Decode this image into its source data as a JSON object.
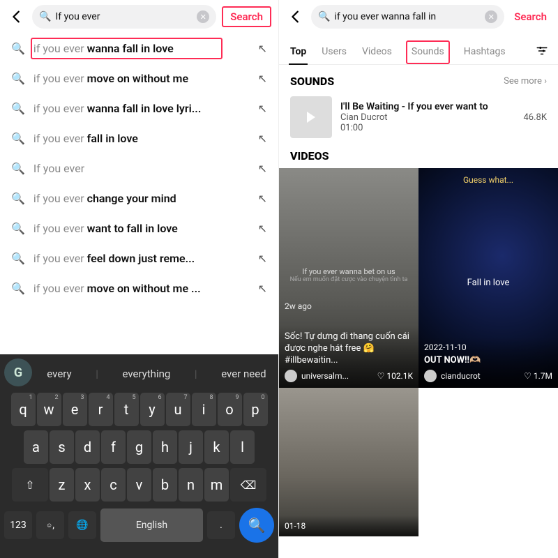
{
  "left": {
    "search_value": "If you ever",
    "search_button": "Search",
    "suggestions": [
      {
        "light": "if you ever ",
        "bold": "wanna fall in love"
      },
      {
        "light": "if you ever ",
        "bold": "move on without me"
      },
      {
        "light": "if you ever ",
        "bold": "wanna fall in love lyri..."
      },
      {
        "light": "if you ever ",
        "bold": "fall in love"
      },
      {
        "light": "If you ever",
        "bold": ""
      },
      {
        "light": "if you ever ",
        "bold": "change your mind"
      },
      {
        "light": "if you ever ",
        "bold": "want to fall in love"
      },
      {
        "light": "if you ever ",
        "bold": "feel down just reme..."
      },
      {
        "light": "if you ever ",
        "bold": "move on without me ..."
      }
    ],
    "keyboard": {
      "predictions": [
        "every",
        "everything",
        "ever need"
      ],
      "row1_sups": [
        "1",
        "2",
        "3",
        "4",
        "5",
        "6",
        "7",
        "8",
        "9",
        "0"
      ],
      "row1": [
        "q",
        "w",
        "e",
        "r",
        "t",
        "y",
        "u",
        "i",
        "o",
        "p"
      ],
      "row2": [
        "a",
        "s",
        "d",
        "f",
        "g",
        "h",
        "j",
        "k",
        "l"
      ],
      "row3": [
        "z",
        "x",
        "c",
        "v",
        "b",
        "n",
        "m"
      ],
      "shift": "⇧",
      "backspace": "⌫",
      "num_key": "123",
      "emoji": "☺",
      "globe": "🌐",
      "space": "English",
      "period": ".",
      "search_icon": "🔍",
      "comma": ","
    }
  },
  "right": {
    "search_value": "if you ever wanna fall in",
    "search_button": "Search",
    "tabs": [
      "Top",
      "Users",
      "Videos",
      "Sounds",
      "Hashtags"
    ],
    "sounds_header": "SOUNDS",
    "see_more": "See more",
    "sound": {
      "title": "I'll Be Waiting - If you ever want to",
      "artist": "Cian Ducrot",
      "duration": "01:00",
      "plays": "46.8K"
    },
    "videos_header": "VIDEOS",
    "videos": [
      {
        "date": "2w ago",
        "caption": "Sốc! Tự dưng đi thang cuốn cái được nghe hát free 🤗 #illbewaitin...",
        "inner_caption_top": "If you ever wanna bet on us",
        "inner_caption_sub": "Nếu em muốn đặt cược vào chuyện tình ta",
        "user": "universalm...",
        "likes": "102.1K"
      },
      {
        "top_text": "Guess what...",
        "mid_text": "Fall in love",
        "date": "2022-11-10",
        "caption": "OUT NOW!!🫶🏼",
        "user": "cianducrot",
        "likes": "1.7M"
      },
      {
        "date": "01-18"
      }
    ]
  }
}
